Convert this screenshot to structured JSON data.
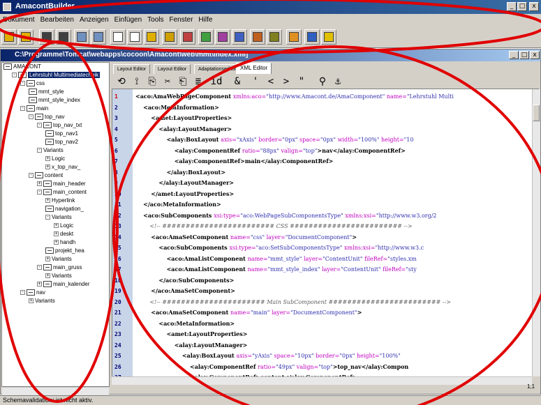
{
  "window": {
    "title": "AmacontBuilder",
    "min": "_",
    "max": "□",
    "close": "x"
  },
  "menu": [
    "Dokument",
    "Bearbeiten",
    "Anzeigen",
    "Einfügen",
    "Tools",
    "Fenster",
    "Hilfe"
  ],
  "toolbar_icons": [
    "open-folder-icon",
    "folder-icon",
    "save-icon",
    "save-all-icon",
    "search-icon",
    "search-replace-icon",
    "copy-icon",
    "cut-icon",
    "paste-icon",
    "component-icon",
    "component-2-icon",
    "component-3-icon",
    "component-4-icon",
    "component-5-icon",
    "component-6-icon",
    "component-7-icon",
    "settings-icon",
    "help-icon",
    "warning-icon"
  ],
  "document": {
    "title": "C:\\Programme\\Tomcat\\webapps\\cocoon\\Amacont\\web\\mmt\\index.xml]"
  },
  "tree": [
    {
      "label": "AMACONT",
      "level": 0,
      "exp": "",
      "icon": true
    },
    {
      "label": "Lehrstuhl Multimediatechnik",
      "level": 1,
      "exp": "-",
      "icon": true,
      "selected": true
    },
    {
      "label": "css",
      "level": 2,
      "exp": "-",
      "icon": true
    },
    {
      "label": "mmt_style",
      "level": 3,
      "exp": "",
      "icon": true
    },
    {
      "label": "mmt_style_index",
      "level": 3,
      "exp": "",
      "icon": true
    },
    {
      "label": "main",
      "level": 2,
      "exp": "-",
      "icon": true
    },
    {
      "label": "top_nav",
      "level": 3,
      "exp": "-",
      "icon": true
    },
    {
      "label": "top_nav_txt",
      "level": 4,
      "exp": "-",
      "icon": true
    },
    {
      "label": "top_nav1",
      "level": 5,
      "exp": "",
      "icon": true
    },
    {
      "label": "top_nav2",
      "level": 5,
      "exp": "",
      "icon": true
    },
    {
      "label": "Variants",
      "level": 4,
      "exp": "-",
      "icon": false
    },
    {
      "label": "Logic",
      "level": 5,
      "exp": "+",
      "icon": false
    },
    {
      "label": "x_top_nav_",
      "level": 5,
      "exp": "+",
      "icon": false
    },
    {
      "label": "content",
      "level": 3,
      "exp": "-",
      "icon": true
    },
    {
      "label": "main_header",
      "level": 4,
      "exp": "+",
      "icon": true
    },
    {
      "label": "main_content",
      "level": 4,
      "exp": "-",
      "icon": true
    },
    {
      "label": "Hyperlink",
      "level": 5,
      "exp": "+",
      "icon": false
    },
    {
      "label": "navigation_",
      "level": 5,
      "exp": "",
      "icon": true
    },
    {
      "label": "Variants",
      "level": 5,
      "exp": "-",
      "icon": false
    },
    {
      "label": "Logic",
      "level": 6,
      "exp": "+",
      "icon": false
    },
    {
      "label": "deskt",
      "level": 6,
      "exp": "+",
      "icon": false
    },
    {
      "label": "handh",
      "level": 6,
      "exp": "+",
      "icon": false
    },
    {
      "label": "projekt_hea",
      "level": 5,
      "exp": "",
      "icon": true
    },
    {
      "label": "Variants",
      "level": 5,
      "exp": "+",
      "icon": false
    },
    {
      "label": "main_gruss",
      "level": 4,
      "exp": "-",
      "icon": true
    },
    {
      "label": "Variants",
      "level": 5,
      "exp": "+",
      "icon": false
    },
    {
      "label": "main_kalender",
      "level": 4,
      "exp": "+",
      "icon": true
    },
    {
      "label": "nav",
      "level": 2,
      "exp": "-",
      "icon": true
    },
    {
      "label": "Variants",
      "level": 3,
      "exp": "+",
      "icon": false
    }
  ],
  "tabs": [
    "Layout Editor",
    "Layout Editor",
    "Adaptationseditor",
    "XML Editor"
  ],
  "editor_toolbar": [
    "⟲",
    "⟟",
    "⎘",
    "✂",
    "⎗",
    "≣",
    "id",
    "&",
    "'",
    "<",
    ">",
    "\"",
    "⚲",
    "⚓"
  ],
  "code_lines": [
    [
      [
        "tag",
        "<aco:AmaWebPageComponent "
      ],
      [
        "attr",
        "xmlns:aco="
      ],
      [
        "val",
        "\"http://www.Amacont.de/AmaComponent\" "
      ],
      [
        "attr",
        "name="
      ],
      [
        "val",
        "\"Lehrstuhl Multi"
      ]
    ],
    [
      [
        "tag",
        "    <aco:MetaInformation>"
      ]
    ],
    [
      [
        "tag",
        "        <amet:LayoutProperties>"
      ]
    ],
    [
      [
        "tag",
        "            <alay:LayoutManager>"
      ]
    ],
    [
      [
        "tag",
        "                <alay:BoxLayout "
      ],
      [
        "attr",
        "axis="
      ],
      [
        "val",
        "\"xAxis\" "
      ],
      [
        "attr",
        "border="
      ],
      [
        "val",
        "\"0px\" "
      ],
      [
        "attr",
        "space="
      ],
      [
        "val",
        "\"0px\" "
      ],
      [
        "attr",
        "width="
      ],
      [
        "val",
        "\"100%\" "
      ],
      [
        "attr",
        "height="
      ],
      [
        "val",
        "\"10"
      ]
    ],
    [
      [
        "tag",
        "                    <alay:ComponentRef "
      ],
      [
        "attr",
        "ratio="
      ],
      [
        "val",
        "\"88px\" "
      ],
      [
        "attr",
        "valign="
      ],
      [
        "val",
        "\"top\""
      ],
      [
        "tag",
        ">"
      ],
      [
        "txt",
        "nav"
      ],
      [
        "tag",
        "</alay:ComponentRef>"
      ]
    ],
    [
      [
        "tag",
        "                    <alay:ComponentRef>"
      ],
      [
        "txt",
        "main"
      ],
      [
        "tag",
        "</alay:ComponentRef>"
      ]
    ],
    [
      [
        "tag",
        "                </alay:BoxLayout>"
      ]
    ],
    [
      [
        "tag",
        "            </alay:LayoutManager>"
      ]
    ],
    [
      [
        "tag",
        "        </amet:LayoutProperties>"
      ]
    ],
    [
      [
        "tag",
        "    </aco:MetaInformation>"
      ]
    ],
    [
      [
        "tag",
        "    <aco:SubComponents "
      ],
      [
        "attr",
        "xsi:type="
      ],
      [
        "val",
        "\"aco:WebPageSubComponentsType\" "
      ],
      [
        "attr",
        "xmlns:xsi="
      ],
      [
        "val",
        "\"http://www.w3.org/2"
      ]
    ],
    [
      [
        "cmt",
        "        <!-- ######################## CSS ######################## -->"
      ]
    ],
    [
      [
        "tag",
        "        <aco:AmaSetComponent "
      ],
      [
        "attr",
        "name="
      ],
      [
        "val",
        "\"css\" "
      ],
      [
        "attr",
        "layer="
      ],
      [
        "val",
        "\"DocumentComponent\""
      ],
      [
        "tag",
        ">"
      ]
    ],
    [
      [
        "tag",
        "            <aco:SubComponents "
      ],
      [
        "attr",
        "xsi:type="
      ],
      [
        "val",
        "\"aco:SetSubComponentsType\" "
      ],
      [
        "attr",
        "xmlns:xsi="
      ],
      [
        "val",
        "\"http://www.w3.c"
      ]
    ],
    [
      [
        "tag",
        "                <aco:AmaListComponent "
      ],
      [
        "attr",
        "name="
      ],
      [
        "val",
        "\"mmt_style\" "
      ],
      [
        "attr",
        "layer="
      ],
      [
        "val",
        "\"ContentUnit\" "
      ],
      [
        "attr",
        "fileRef="
      ],
      [
        "val",
        "\"styles.xm"
      ]
    ],
    [
      [
        "tag",
        "                <aco:AmaListComponent "
      ],
      [
        "attr",
        "name="
      ],
      [
        "val",
        "\"mmt_style_index\" "
      ],
      [
        "attr",
        "layer="
      ],
      [
        "val",
        "\"ContentUnit\" "
      ],
      [
        "attr",
        "fileRef="
      ],
      [
        "val",
        "\"sty"
      ]
    ],
    [
      [
        "tag",
        "            </aco:SubComponents>"
      ]
    ],
    [
      [
        "tag",
        "        </aco:AmaSetComponent>"
      ]
    ],
    [
      [
        "cmt",
        "        <!-- ###################### Main SubComponent ######################## -->"
      ]
    ],
    [
      [
        "tag",
        "        <aco:AmaSetComponent "
      ],
      [
        "attr",
        "name="
      ],
      [
        "val",
        "\"main\" "
      ],
      [
        "attr",
        "layer="
      ],
      [
        "val",
        "\"DocumentComponent\""
      ],
      [
        "tag",
        ">"
      ]
    ],
    [
      [
        "tag",
        "            <aco:MetaInformation>"
      ]
    ],
    [
      [
        "tag",
        "                <amet:LayoutProperties>"
      ]
    ],
    [
      [
        "tag",
        "                    <alay:LayoutManager>"
      ]
    ],
    [
      [
        "tag",
        "                        <alay:BoxLayout "
      ],
      [
        "attr",
        "axis="
      ],
      [
        "val",
        "\"yAxis\" "
      ],
      [
        "attr",
        "space="
      ],
      [
        "val",
        "\"10px\" "
      ],
      [
        "attr",
        "border="
      ],
      [
        "val",
        "\"0px\" "
      ],
      [
        "attr",
        "height="
      ],
      [
        "val",
        "\"100%\""
      ]
    ],
    [
      [
        "tag",
        "                            <alay:ComponentRef "
      ],
      [
        "attr",
        "ratio="
      ],
      [
        "val",
        "\"49px\" "
      ],
      [
        "attr",
        "valign="
      ],
      [
        "val",
        "\"top\""
      ],
      [
        "tag",
        ">"
      ],
      [
        "txt",
        "top_nav"
      ],
      [
        "tag",
        "</alay:Compon"
      ]
    ],
    [
      [
        "tag",
        "                            <alay:ComponentRef>"
      ],
      [
        "txt",
        "content"
      ],
      [
        "tag",
        "</alay:ComponentRef>"
      ]
    ]
  ],
  "cursor": "1,1",
  "status": "Schemavalidation: ist nicht aktiv."
}
